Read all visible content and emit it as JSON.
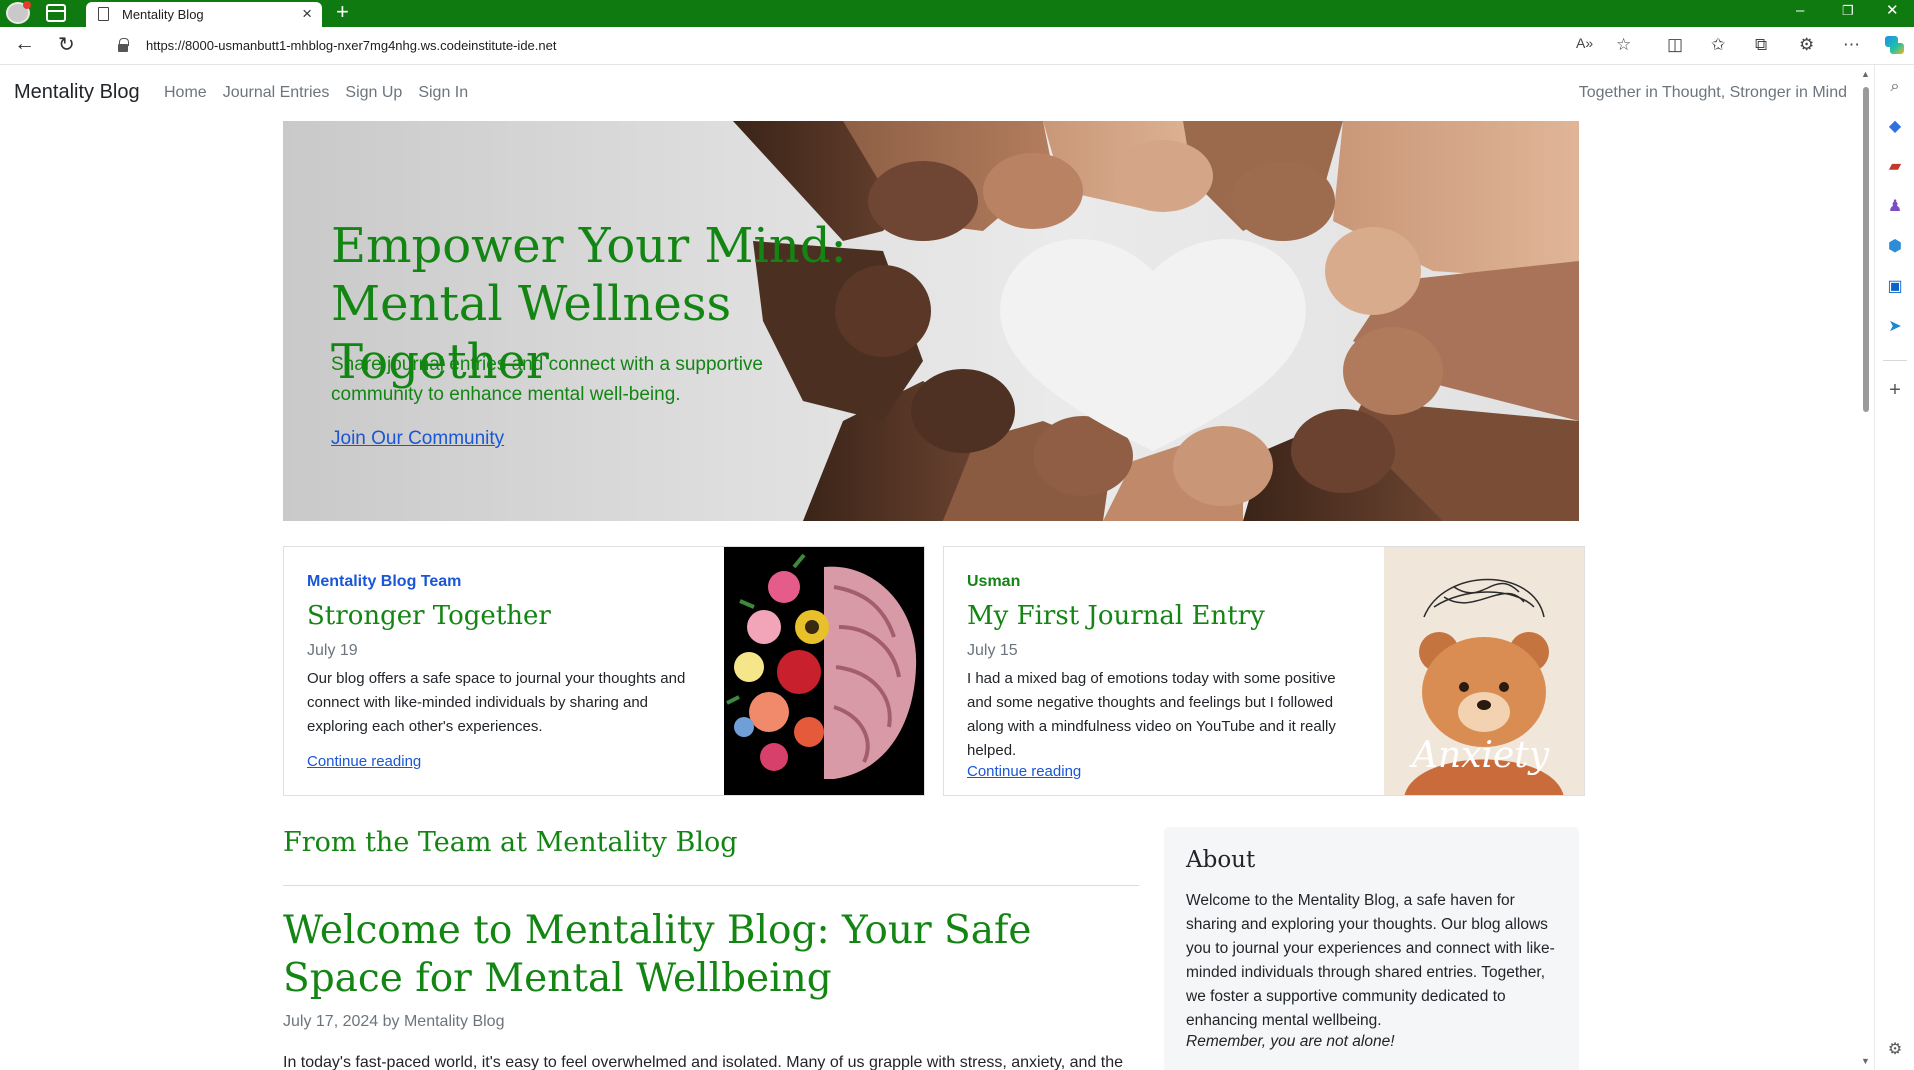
{
  "browser": {
    "tab_title": "Mentality Blog",
    "url": "https://8000-usmanbutt1-mhblog-nxer7mg4nhg.ws.codeinstitute-ide.net",
    "icons": [
      "profile-icon",
      "tab-actions-icon",
      "page-icon",
      "close-icon",
      "new-tab-icon",
      "back-icon",
      "refresh-icon",
      "lock-icon",
      "read-aloud-icon",
      "favorite-icon",
      "split-screen-icon",
      "favorites-icon",
      "collections-icon",
      "extensions-icon",
      "more-icon",
      "copilot-icon"
    ],
    "window_controls": {
      "minimize": "–",
      "restore": "❐",
      "close": "✕"
    }
  },
  "navbar": {
    "brand": "Mentality Blog",
    "links": [
      "Home",
      "Journal Entries",
      "Sign Up",
      "Sign In"
    ],
    "tagline": "Together in Thought, Stronger in Mind"
  },
  "hero": {
    "title": "Empower Your Mind: Mental Wellness Together",
    "subtitle": "Share journal entries and connect with a supportive community to enhance mental well-being.",
    "cta": "Join Our Community"
  },
  "cards": [
    {
      "author": "Mentality Blog Team",
      "author_color": "#1a56d6",
      "title": "Stronger Together",
      "date": "July 19",
      "excerpt": "Our blog offers a safe space to journal your thoughts and connect with like-minded individuals by sharing and exploring each other's experiences.",
      "link": "Continue reading"
    },
    {
      "author": "Usman",
      "author_color": "#138513",
      "title": "My First Journal Entry",
      "date": "July 15",
      "excerpt": "I had a mixed bag of emotions today with some positive and some negative thoughts and feelings but I followed along with a mindfulness video on YouTube and it really helped.",
      "link": "Continue reading",
      "image_caption": "Anxiety"
    }
  ],
  "main": {
    "section_heading": "From the Team at Mentality Blog",
    "post_title": "Welcome to Mentality Blog: Your Safe Space for Mental Wellbeing",
    "post_meta": "July 17, 2024 by Mentality Blog",
    "post_text": "In today's fast-paced world, it's easy to feel overwhelmed and isolated. Many of us grapple with stress, anxiety, and the"
  },
  "about": {
    "title": "About",
    "text": "Welcome to the Mentality Blog, a safe haven for sharing and exploring your thoughts. Our blog allows you to journal your experiences and connect with like-minded individuals through shared entries. Together, we foster a supportive community dedicated to enhancing mental wellbeing.",
    "note": "Remember, you are not alone!"
  },
  "colors": {
    "brand_green": "#138513",
    "link_blue": "#1a56d6",
    "tabbar": "#0f7a0f"
  }
}
